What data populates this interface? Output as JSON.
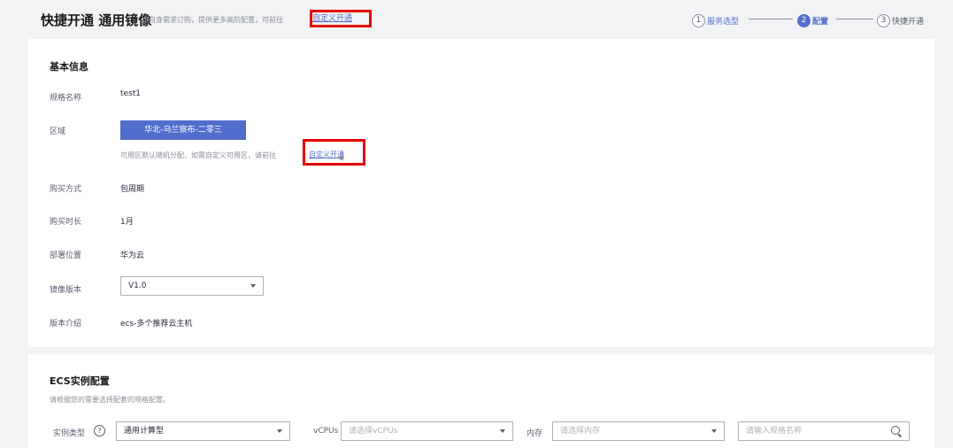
{
  "header": {
    "title": "快捷开通 通用镜像",
    "subtitle": "按自身需求订购，提供更多高阶配置，可前往",
    "custom_link": "自定义开通"
  },
  "steps": [
    {
      "num": "1",
      "label": "服务选型"
    },
    {
      "num": "2",
      "label": "配置"
    },
    {
      "num": "3",
      "label": "快捷开通"
    }
  ],
  "basic": {
    "title": "基本信息",
    "spec_name_label": "规格名称",
    "spec_name_value": "test1",
    "region_label": "区域",
    "region_value": "华北-乌兰察布-二零三",
    "region_hint": "可用区默认随机分配，如需自定义可用区，请前往",
    "region_custom_link": "自定义开通",
    "purchase_mode_label": "购买方式",
    "purchase_mode_value": "包周期",
    "duration_label": "购买时长",
    "duration_value": "1月",
    "location_label": "部署位置",
    "location_value": "华为云",
    "image_version_label": "镜像版本",
    "image_version_value": "V1.0",
    "version_desc_label": "版本介绍",
    "version_desc_value": "ecs-多个推荐云主机"
  },
  "ecs": {
    "title": "ECS实例配置",
    "desc": "请根据您的需要选择配套的规格配置。",
    "instance_type_label": "实例类型",
    "help_glyph": "?",
    "instance_type_value": "通用计算型",
    "vcpus_label": "vCPUs",
    "vcpus_placeholder": "请选择vCPUs",
    "memory_label": "内存",
    "memory_placeholder": "请选择内存",
    "spec_search_placeholder": "请输入规格名称"
  },
  "colors": {
    "accent": "#526ecc",
    "highlight_box": "#e60000"
  }
}
